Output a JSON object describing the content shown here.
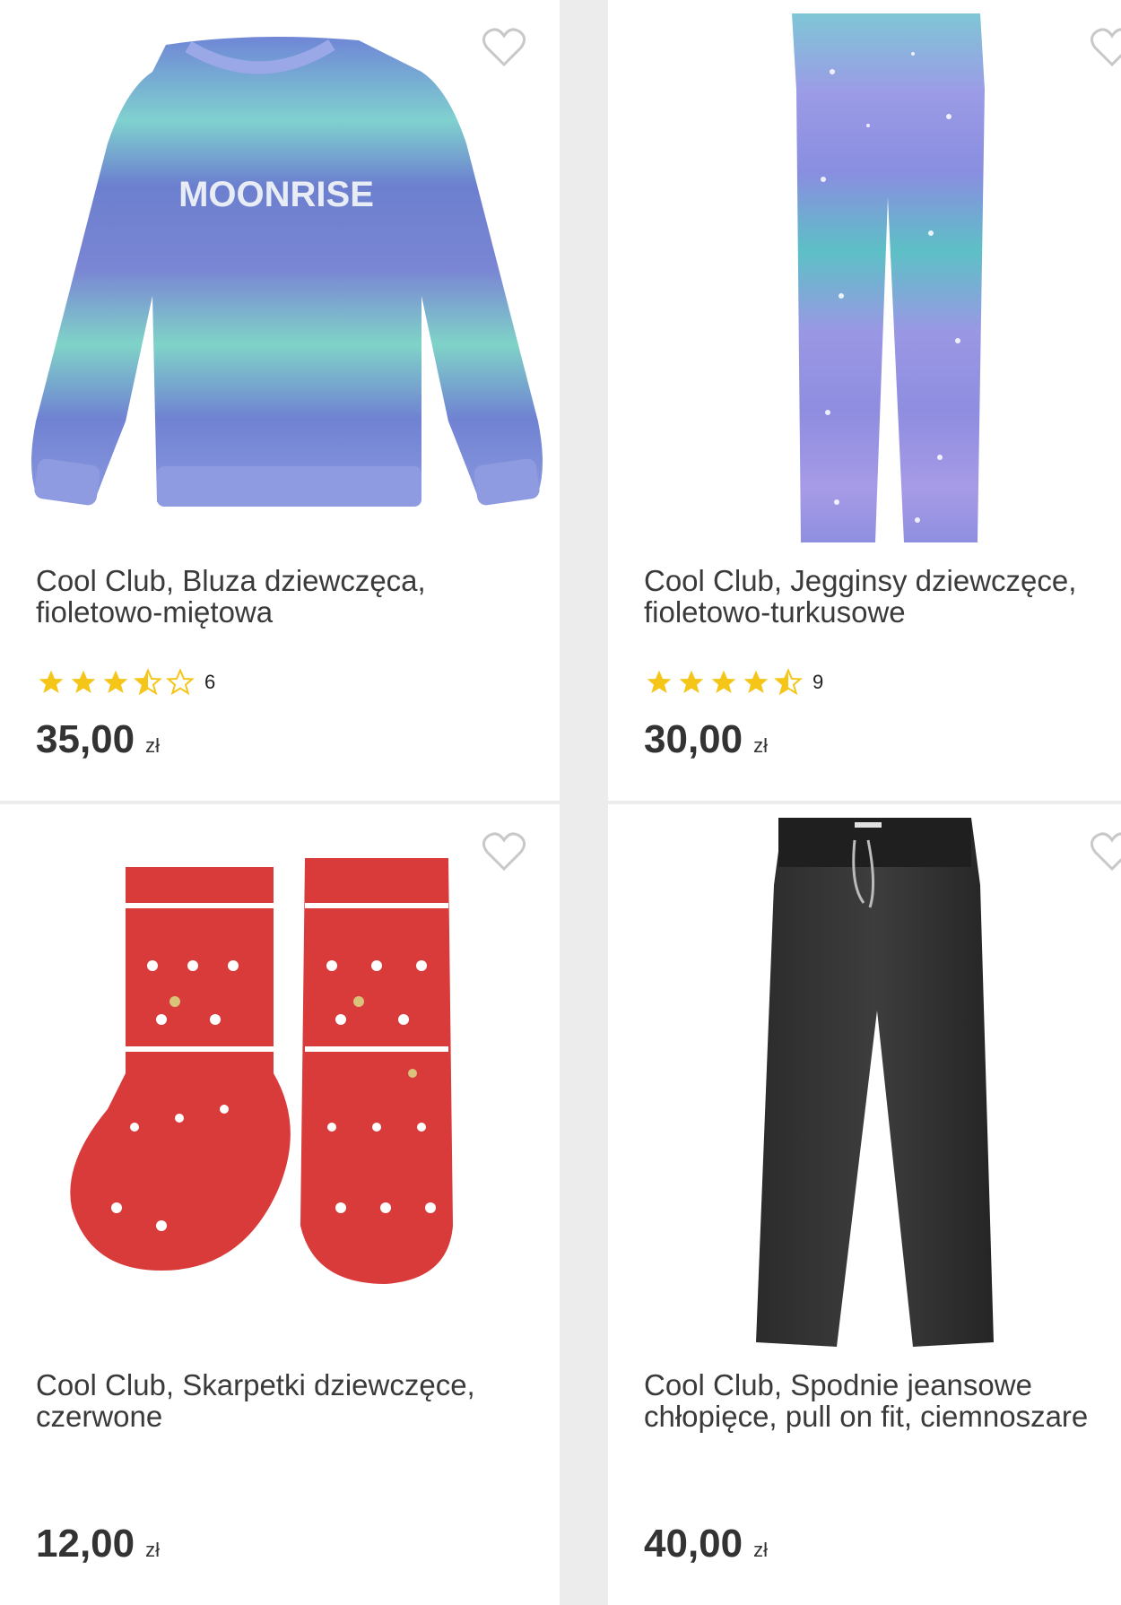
{
  "products": [
    {
      "name": "Cool Club, Bluza dziewczęca, fioletowo-miętowa",
      "name_line1": "Cool Club, Bluza dziewczęca,",
      "name_line2": "fioletowo-miętowa",
      "rating": 3.5,
      "rating_count": "6",
      "price": "35,00",
      "currency": "zł",
      "image_text": "MOONRISE"
    },
    {
      "name": "Cool Club, Jegginsy dziewczęce, fioletowo-turkusowe",
      "name_line1": "Cool Club, Jegginsy dziewczęce,",
      "name_line2": "fioletowo-turkusowe",
      "rating": 4.5,
      "rating_count": "9",
      "price": "30,00",
      "currency": "zł"
    },
    {
      "name": "Cool Club, Skarpetki dziewczęce, czerwone",
      "name_line1": "Cool Club, Skarpetki dziewczęce,",
      "name_line2": "czerwone",
      "price": "12,00",
      "currency": "zł"
    },
    {
      "name": "Cool Club, Spodnie jeansowe chłopięce, pull on fit, ciemnoszare",
      "name_line1": "Cool Club, Spodnie jeansowe",
      "name_line2": "chłopięce, pull on fit, ciemnoszare",
      "price": "40,00",
      "currency": "zł"
    }
  ],
  "colors": {
    "star_filled": "#f5c518",
    "star_empty": "#f5c518",
    "heart_outline": "#c8c8c8",
    "page_bg": "#ececec",
    "card_bg": "#ffffff"
  },
  "icons": {
    "favorite": "heart-outline-icon",
    "rating_star": "star-icon"
  }
}
